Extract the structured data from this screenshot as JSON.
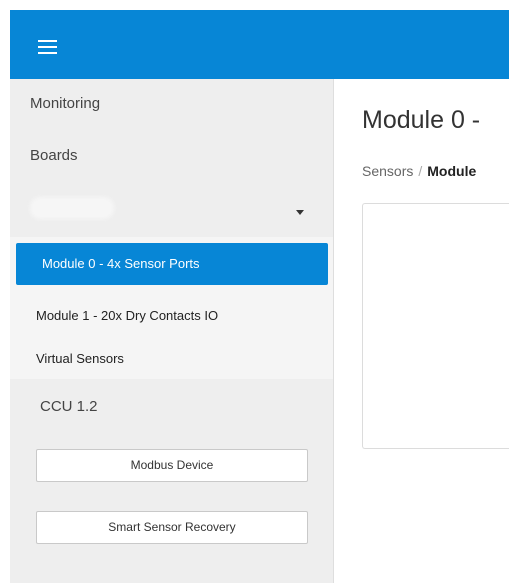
{
  "header": {
    "menu_icon": "hamburger-menu-icon",
    "accent": "#0786d6"
  },
  "sidebar": {
    "monitoring_label": "Monitoring",
    "boards_label": "Boards",
    "dropdown_value": "",
    "modules": [
      {
        "label": "Module 0 - 4x Sensor Ports",
        "active": true
      },
      {
        "label": "Module 1 - 20x Dry Contacts IO",
        "active": false
      },
      {
        "label": "Virtual Sensors",
        "active": false
      }
    ],
    "ccu_label": "CCU 1.2",
    "buttons": {
      "modbus": "Modbus Device",
      "recovery": "Smart Sensor Recovery"
    }
  },
  "main": {
    "title": "Module 0 -",
    "breadcrumb": {
      "root": "Sensors",
      "separator": "/",
      "current": "Module"
    }
  }
}
